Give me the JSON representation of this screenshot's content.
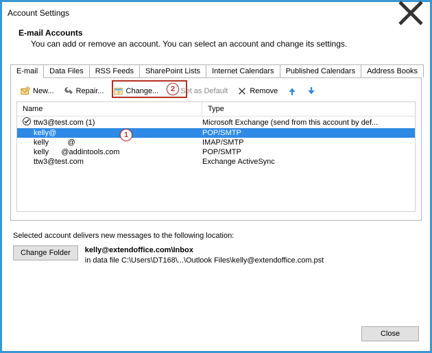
{
  "window": {
    "title": "Account Settings"
  },
  "header": {
    "title": "E-mail Accounts",
    "subtitle": "You can add or remove an account. You can select an account and change its settings."
  },
  "tabs": [
    {
      "label": "E-mail"
    },
    {
      "label": "Data Files"
    },
    {
      "label": "RSS Feeds"
    },
    {
      "label": "SharePoint Lists"
    },
    {
      "label": "Internet Calendars"
    },
    {
      "label": "Published Calendars"
    },
    {
      "label": "Address Books"
    }
  ],
  "toolbar": {
    "new": "New...",
    "repair": "Repair...",
    "change": "Change...",
    "set_default": "Set as Default",
    "remove": "Remove"
  },
  "columns": {
    "name": "Name",
    "type": "Type"
  },
  "accounts": [
    {
      "name": "ttw3@test.com (1)",
      "type": "Microsoft Exchange (send from this account by def...",
      "default": true
    },
    {
      "name": "kelly@",
      "type": "POP/SMTP",
      "selected": true
    },
    {
      "name": "kelly         @",
      "type": "IMAP/SMTP"
    },
    {
      "name": "kelly      @addintools.com",
      "type": "POP/SMTP"
    },
    {
      "name": "ttw3@test.com",
      "type": "Exchange ActiveSync"
    }
  ],
  "callouts": {
    "one": "1",
    "two": "2"
  },
  "footer": {
    "label": "Selected account delivers new messages to the following location:",
    "change_folder": "Change Folder",
    "path_bold": "kelly@extendoffice.com\\Inbox",
    "path_detail": "in data file C:\\Users\\DT168\\...\\Outlook Files\\kelly@extendoffice.com.pst"
  },
  "buttons": {
    "close": "Close"
  }
}
